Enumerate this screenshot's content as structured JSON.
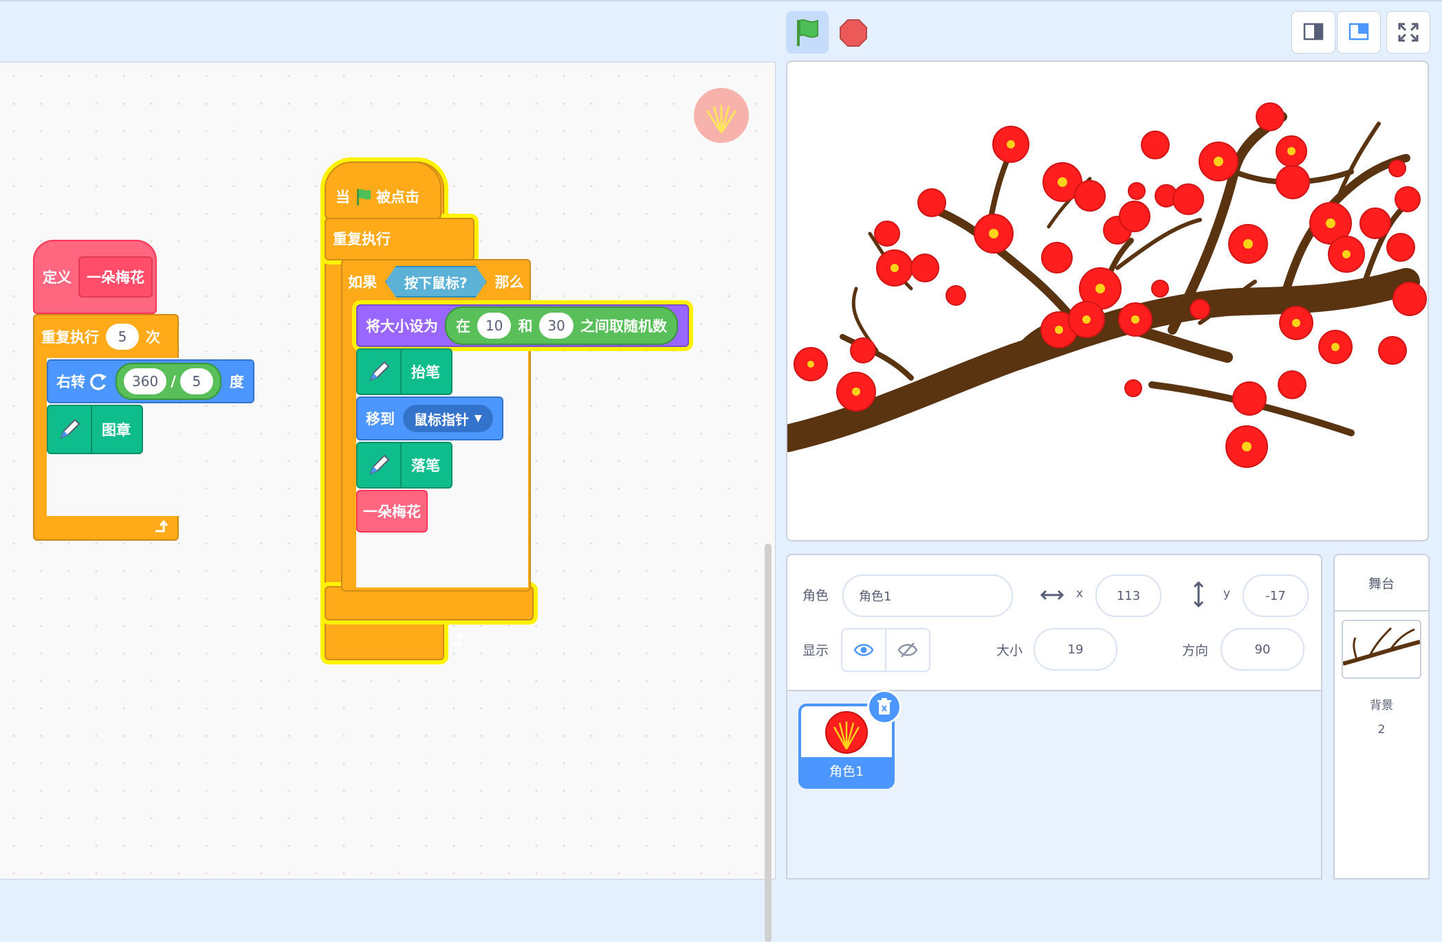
{
  "toolbar": {
    "green_flag": "green-flag-icon",
    "stop": "stop-icon",
    "small_stage": "small-stage-icon",
    "large_stage": "large-stage-icon",
    "fullscreen": "fullscreen-icon"
  },
  "define_script": {
    "define_label": "定义",
    "custom_name": "一朵梅花",
    "repeat_label": "重复执行",
    "repeat_count": "5",
    "repeat_suffix": "次",
    "turn_label": "右转",
    "turn_dividend": "360",
    "turn_op": "/",
    "turn_divisor": "5",
    "turn_unit": "度",
    "stamp_label": "图章"
  },
  "main_script": {
    "when_label": "当",
    "clicked_label": "被点击",
    "forever_label": "重复执行",
    "if_label": "如果",
    "mouse_down": "按下鼠标?",
    "then_label": "那么",
    "set_size_label": "将大小设为",
    "random_in": "在",
    "random_from": "10",
    "random_and": "和",
    "random_to": "30",
    "random_suffix": "之间取随机数",
    "pen_up": "抬笔",
    "goto_label": "移到",
    "goto_target": "鼠标指针",
    "pen_down": "落笔",
    "call_custom": "一朵梅花"
  },
  "sprite_info": {
    "sprite_label": "角色",
    "sprite_name": "角色1",
    "x_label": "x",
    "x_value": "113",
    "y_label": "y",
    "y_value": "-17",
    "show_label": "显示",
    "size_label": "大小",
    "size_value": "19",
    "direction_label": "方向",
    "direction_value": "90"
  },
  "sprite_list": [
    {
      "name": "角色1"
    }
  ],
  "stage_panel": {
    "title": "舞台",
    "backdrops_label": "背景",
    "backdrops_count": "2"
  },
  "colors": {
    "events": "#ffab19",
    "control": "#ffab19",
    "custom": "#ff6680",
    "motion": "#4c97ff",
    "pen": "#0fbd8c",
    "looks": "#9966ff",
    "operators": "#59c059",
    "sensing": "#5cb1d6",
    "glow": "#fff200",
    "blossom": "#ff1e1e",
    "branch": "#5a3311"
  }
}
